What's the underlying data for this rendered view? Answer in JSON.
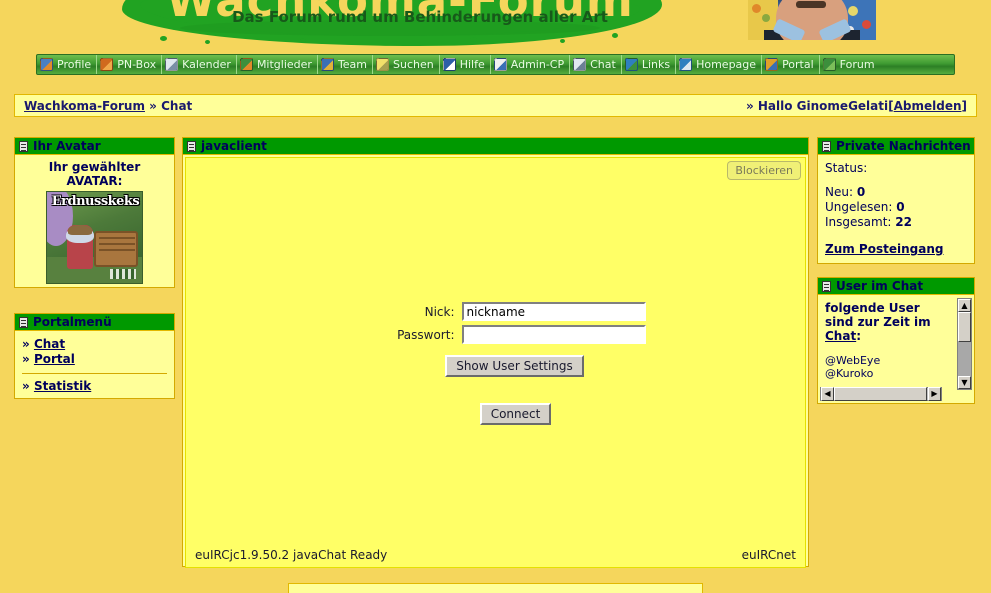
{
  "site": {
    "logo_text": "Wachkoma-Forum",
    "tagline": "Das Forum rund um Behinderungen aller Art"
  },
  "nav": {
    "items": [
      {
        "label": "Profile",
        "icon": "profile-icon"
      },
      {
        "label": "PN-Box",
        "icon": "mailbox-icon"
      },
      {
        "label": "Kalender",
        "icon": "calendar-icon"
      },
      {
        "label": "Mitglieder",
        "icon": "members-icon"
      },
      {
        "label": "Team",
        "icon": "team-icon"
      },
      {
        "label": "Suchen",
        "icon": "search-icon"
      },
      {
        "label": "Hilfe",
        "icon": "help-icon"
      },
      {
        "label": "Admin-CP",
        "icon": "admin-icon"
      },
      {
        "label": "Chat",
        "icon": "chat-bubble-icon"
      },
      {
        "label": "Links",
        "icon": "links-icon"
      },
      {
        "label": "Homepage",
        "icon": "globe-icon"
      },
      {
        "label": "Portal",
        "icon": "portal-icon"
      },
      {
        "label": "Forum",
        "icon": "forum-icon"
      }
    ]
  },
  "breadcrumb": {
    "root": "Wachkoma-Forum",
    "separator": "»",
    "current": "Chat",
    "greeting_prefix": "» Hallo ",
    "username": "GinomeGelati",
    "logout_open": "[",
    "logout_label": "Abmelden",
    "logout_close": "]"
  },
  "avatar_panel": {
    "title": "Ihr Avatar",
    "heading_line1": "Ihr gewählter",
    "heading_line2": "AVATAR:",
    "image_caption": "Erdnusskeks"
  },
  "portal_panel": {
    "title": "Portalmenü",
    "bullet": "»",
    "items": [
      {
        "label": "Chat"
      },
      {
        "label": "Portal"
      }
    ],
    "extra": [
      {
        "label": "Statistik"
      }
    ]
  },
  "pn_panel": {
    "title": "Private Nachrichten",
    "status_label": "Status:",
    "rows": [
      {
        "label": "Neu:",
        "value": "0"
      },
      {
        "label": "Ungelesen:",
        "value": "0"
      },
      {
        "label": "Insgesamt:",
        "value": "22"
      }
    ],
    "link": "Zum Posteingang"
  },
  "users_panel": {
    "title": "User im Chat",
    "heading_line1": "folgende User",
    "heading_line2": "sind zur Zeit im",
    "heading_link": "Chat",
    "heading_colon": ":",
    "users": [
      "@WebEye",
      "@Kuroko"
    ]
  },
  "applet": {
    "title": "javaclient",
    "block_button": "Blockieren",
    "nick_label": "Nick:",
    "nick_value": "nickname",
    "password_label": "Passwort:",
    "password_value": "",
    "settings_button": "Show User Settings",
    "connect_button": "Connect",
    "status_left": "euIRCjc1.9.50.2 javaChat Ready",
    "status_right": "euIRCnet"
  },
  "colors": {
    "page_bg": "#f5d65c",
    "panel_bg": "#ffff99",
    "panel_header": "#009900",
    "applet_bg": "#ffff66",
    "text": "#00005c",
    "nav_green": "#3f9b32",
    "border": "#e2b800"
  }
}
